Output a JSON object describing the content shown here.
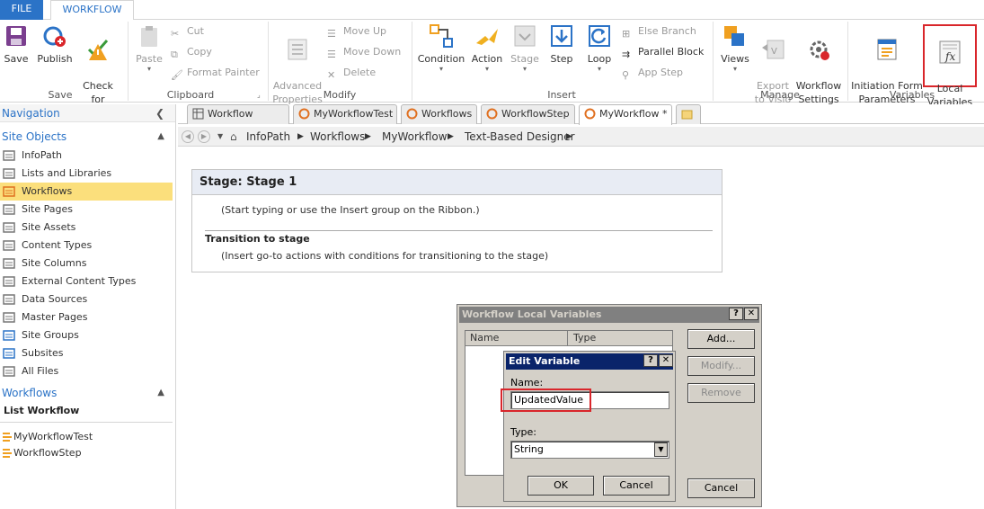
{
  "tabs": {
    "file": "FILE",
    "workflow": "WORKFLOW"
  },
  "ribbon": {
    "save": {
      "save": "Save",
      "publish": "Publish",
      "check": "Check\nfor Errors",
      "group": "Save"
    },
    "clipboard": {
      "paste": "Paste",
      "cut": "Cut",
      "copy": "Copy",
      "format_painter": "Format Painter",
      "group": "Clipboard"
    },
    "modify": {
      "advanced": "Advanced\nProperties",
      "move_up": "Move Up",
      "move_down": "Move Down",
      "delete": "Delete",
      "group": "Modify"
    },
    "insert": {
      "condition": "Condition",
      "action": "Action",
      "stage": "Stage",
      "step": "Step",
      "loop": "Loop",
      "else_branch": "Else Branch",
      "parallel_block": "Parallel Block",
      "app_step": "App Step",
      "group": "Insert"
    },
    "manage": {
      "views": "Views",
      "export": "Export\nto Visio",
      "settings": "Workflow\nSettings",
      "group": "Manage"
    },
    "variables": {
      "initiation": "Initiation Form\nParameters",
      "local": "Local\nVariables",
      "group": "Variables"
    }
  },
  "nav": {
    "title": "Navigation",
    "site_objects": "Site Objects",
    "items": [
      "InfoPath",
      "Lists and Libraries",
      "Workflows",
      "Site Pages",
      "Site Assets",
      "Content Types",
      "Site Columns",
      "External Content Types",
      "Data Sources",
      "Master Pages",
      "Site Groups",
      "Subsites",
      "All Files"
    ],
    "workflows_hdr": "Workflows",
    "list_workflow": "List Workflow",
    "workflow_items": [
      "MyWorkflowTest",
      "WorkflowStep"
    ]
  },
  "doc_tabs": [
    "Workflow History",
    "MyWorkflowTest",
    "Workflows",
    "WorkflowStep",
    "MyWorkflow *"
  ],
  "breadcrumb": [
    "InfoPath",
    "Workflows",
    "MyWorkflow",
    "Text-Based Designer"
  ],
  "stage": {
    "title": "Stage: Stage 1",
    "hint": "(Start typing or use the Insert group on the Ribbon.)",
    "transition_title": "Transition to stage",
    "transition_hint": "(Insert go-to actions with conditions for transitioning to the stage)"
  },
  "local_vars_dialog": {
    "title": "Workflow Local Variables",
    "col_name": "Name",
    "col_type": "Type",
    "add": "Add...",
    "modify": "Modify...",
    "remove": "Remove",
    "cancel": "Cancel"
  },
  "edit_var_dialog": {
    "title": "Edit Variable",
    "name_label": "Name:",
    "name_value": "UpdatedValue",
    "type_label": "Type:",
    "type_value": "String",
    "ok": "OK",
    "cancel": "Cancel"
  },
  "colors": {
    "accent": "#2b73c7",
    "selected": "#fbdf7c",
    "highlight": "#d9262b"
  }
}
